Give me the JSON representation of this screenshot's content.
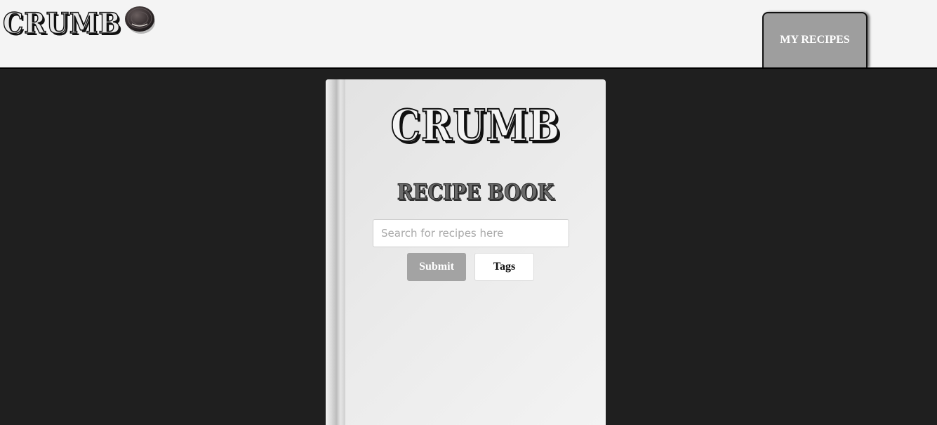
{
  "header": {
    "brand": "CRUMB",
    "brand_icon": "cookie-icon",
    "nav": [
      {
        "label": "MY RECIPES",
        "active": true
      }
    ]
  },
  "book": {
    "title": "CRUMB",
    "subtitle": "RECIPE BOOK",
    "search": {
      "value": "",
      "placeholder": "Search for recipes here"
    },
    "buttons": {
      "submit": "Submit",
      "tags": "Tags"
    }
  },
  "colors": {
    "background": "#1f1f1f",
    "header_bg": "#f4f4f4",
    "tab_bg": "#9e9e9e",
    "submit_bg": "#a3a3a3"
  }
}
